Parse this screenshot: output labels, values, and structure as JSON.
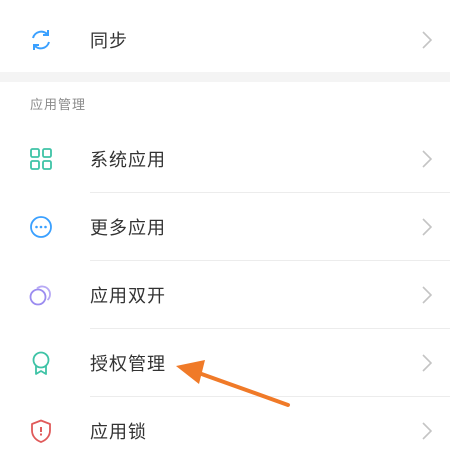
{
  "sync": {
    "label": "同步",
    "icon": "sync-icon"
  },
  "app_management": {
    "header": "应用管理",
    "items": [
      {
        "label": "系统应用",
        "icon": "grid-icon",
        "color": "#3ec3a6"
      },
      {
        "label": "更多应用",
        "icon": "more-icon",
        "color": "#3aa0ff"
      },
      {
        "label": "应用双开",
        "icon": "dual-circle-icon",
        "color": "#9b8cf0"
      },
      {
        "label": "授权管理",
        "icon": "badge-icon",
        "color": "#3ec3a6"
      },
      {
        "label": "应用锁",
        "icon": "shield-icon",
        "color": "#e05a5a"
      }
    ]
  },
  "accent": "#f07a28"
}
